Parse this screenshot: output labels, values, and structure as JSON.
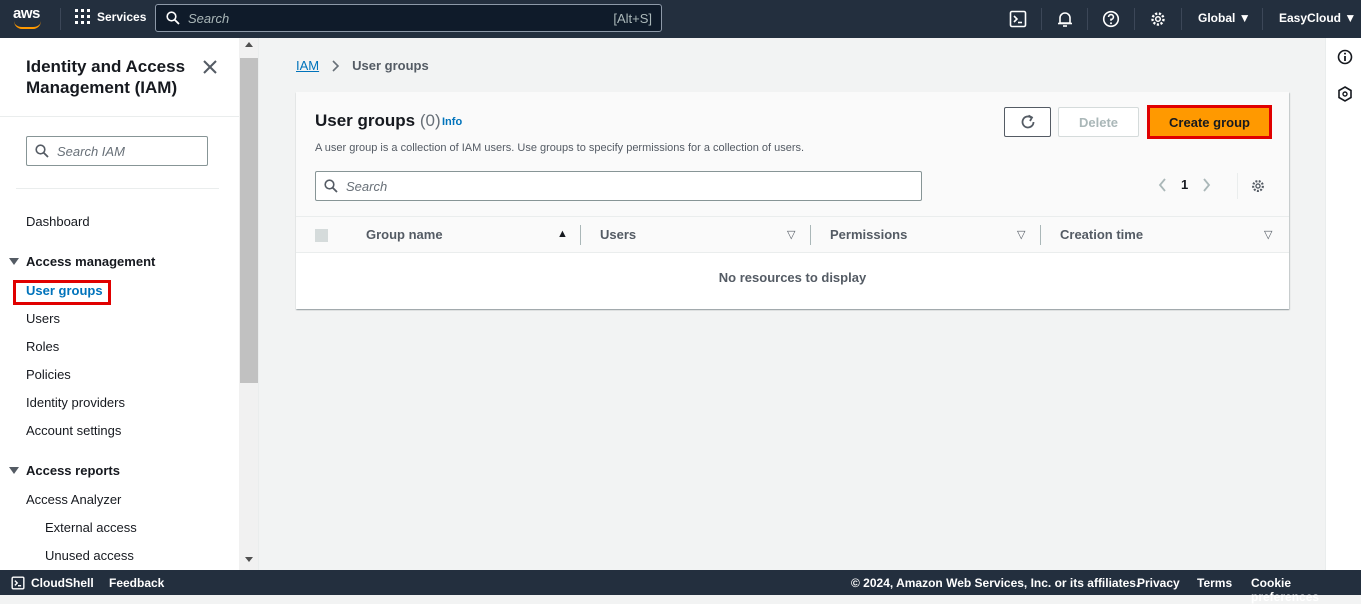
{
  "topnav": {
    "logo_text": "aws",
    "services_label": "Services",
    "search_placeholder": "Search",
    "search_shortcut": "[Alt+S]",
    "region_label": "Global",
    "account_label": "EasyCloud"
  },
  "sidebar": {
    "title": "Identity and Access Management (IAM)",
    "search_placeholder": "Search IAM",
    "dashboard": "Dashboard",
    "access_management": {
      "label": "Access management",
      "items": [
        "User groups",
        "Users",
        "Roles",
        "Policies",
        "Identity providers",
        "Account settings"
      ]
    },
    "access_reports": {
      "label": "Access reports",
      "items": [
        "Access Analyzer"
      ],
      "sub_items": [
        "External access",
        "Unused access"
      ]
    }
  },
  "breadcrumb": {
    "root": "IAM",
    "current": "User groups"
  },
  "panel": {
    "title": "User groups",
    "count": "(0)",
    "info": "Info",
    "description": "A user group is a collection of IAM users. Use groups to specify permissions for a collection of users.",
    "delete_label": "Delete",
    "create_label": "Create group",
    "search_placeholder": "Search",
    "page_number": "1",
    "columns": [
      "Group name",
      "Users",
      "Permissions",
      "Creation time"
    ],
    "empty_text": "No resources to display"
  },
  "footer": {
    "cloudshell": "CloudShell",
    "feedback": "Feedback",
    "copyright": "© 2024, Amazon Web Services, Inc. or its affiliates.",
    "privacy": "Privacy",
    "terms": "Terms",
    "cookies": "Cookie preferences"
  },
  "colors": {
    "nav_bg": "#232f3e",
    "accent_orange": "#ff9900",
    "link_blue": "#0073bb",
    "highlight_red": "#e00000"
  }
}
